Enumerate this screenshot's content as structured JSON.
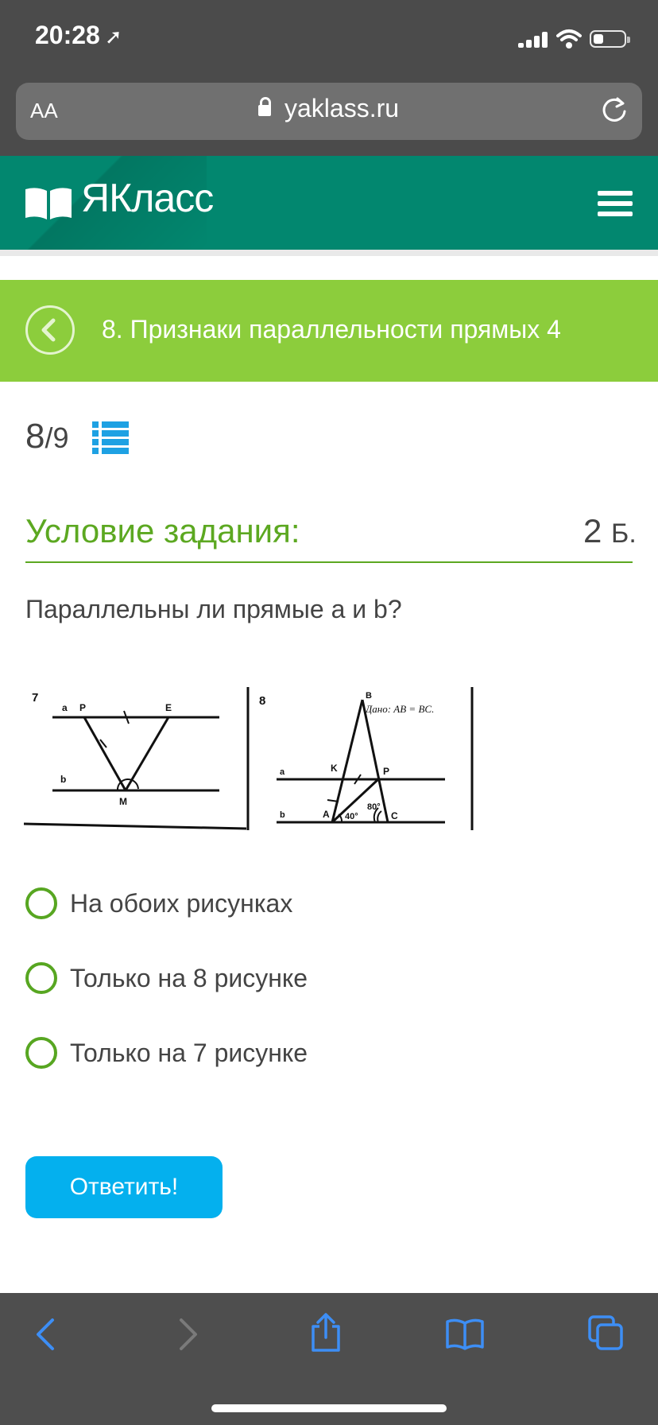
{
  "status_bar": {
    "time": "20:28",
    "location_icon": "location-arrow-icon",
    "battery_level": 0.25
  },
  "browser": {
    "text_size_label": "AA",
    "url": "yaklass.ru"
  },
  "site": {
    "logo_text": "ЯКласс"
  },
  "topic": {
    "title": "8. Признаки параллельности прямых 4"
  },
  "progress": {
    "current": "8",
    "total": "9"
  },
  "task": {
    "condition_title": "Условие задания:",
    "points_value": "2",
    "points_unit": "Б.",
    "question": "Параллельны ли прямые а и b?"
  },
  "figure": {
    "fig7": {
      "number": "7",
      "line_a": "a",
      "line_b": "b",
      "point_p": "P",
      "point_e": "E",
      "point_m": "M"
    },
    "fig8": {
      "number": "8",
      "given": "Дано: AB = BC.",
      "line_a": "a",
      "line_b": "b",
      "point_b": "B",
      "point_k": "K",
      "point_p": "P",
      "point_a": "A",
      "point_c": "C",
      "angle_40": "40°",
      "angle_80": "80°"
    }
  },
  "options": [
    {
      "label": "На обоих рисунках",
      "selected": false
    },
    {
      "label": "Только на 8 рисунке",
      "selected": false
    },
    {
      "label": "Только на 7 рисунке",
      "selected": false
    }
  ],
  "submit_label": "Ответить!",
  "colors": {
    "header": "#02876f",
    "topic_bar": "#8ccd3c",
    "accent_green": "#5ca821",
    "button_blue": "#04b0ee"
  }
}
